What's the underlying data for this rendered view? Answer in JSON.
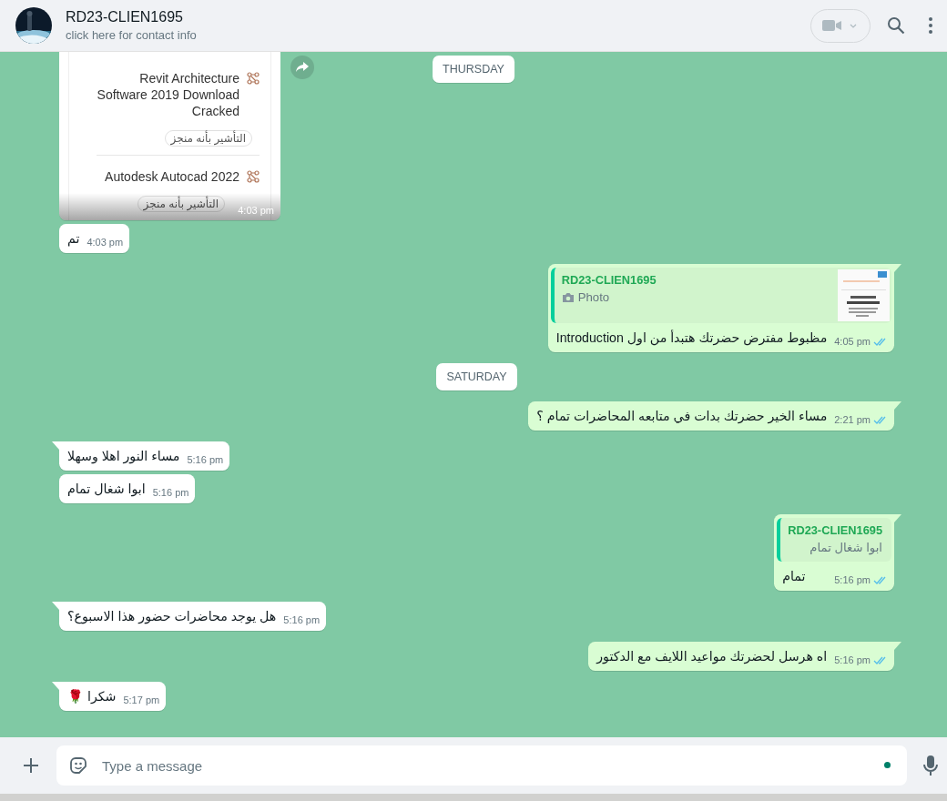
{
  "header": {
    "name": "RD23-CLIEN1695",
    "subtitle": "click here for contact info"
  },
  "sticky_date": "THURSDAY",
  "messages": [
    {
      "kind": "in-screenshot",
      "items": [
        {
          "title": "Revit Architecture Software 2019 Download Cracked",
          "button": "التأشير بأنه منجز"
        },
        {
          "title": "Autodesk Autocad 2022",
          "button": "التأشير بأنه منجز"
        }
      ],
      "time": "4:03 pm"
    },
    {
      "kind": "in",
      "text": "تم",
      "time": "4:03 pm"
    },
    {
      "kind": "out-quote",
      "quote": {
        "name": "RD23-CLIEN1695",
        "text": "Photo"
      },
      "text": "مظبوط مفترض حضرتك هتبدأ من اول  Introduction",
      "time": "4:05 pm",
      "read": true
    },
    {
      "kind": "date",
      "text": "SATURDAY"
    },
    {
      "kind": "out",
      "text": "مساء الخير حضرتك بدات في متابعه المحاضرات تمام ؟",
      "time": "2:21 pm",
      "read": true
    },
    {
      "kind": "in",
      "text": "مساء النور اهلا وسهلا",
      "time": "5:16 pm"
    },
    {
      "kind": "in",
      "text": "ابوا شغال تمام",
      "time": "5:16 pm"
    },
    {
      "kind": "out-quote",
      "quote": {
        "kind": "text",
        "name": "RD23-CLIEN1695",
        "text": "ابوا شغال تمام"
      },
      "text": "تمام",
      "time": "5:16 pm",
      "read": true
    },
    {
      "kind": "in",
      "text": "هل يوجد محاضرات حضور هذا الاسبوع؟",
      "time": "5:16 pm"
    },
    {
      "kind": "out",
      "text": "اه هرسل لحضرتك مواعيد اللايف مع الدكتور",
      "time": "5:16 pm",
      "read": true
    },
    {
      "kind": "in",
      "text": "شكرا 🌹",
      "time": "5:17 pm"
    }
  ],
  "composer": {
    "placeholder": "Type a message"
  }
}
